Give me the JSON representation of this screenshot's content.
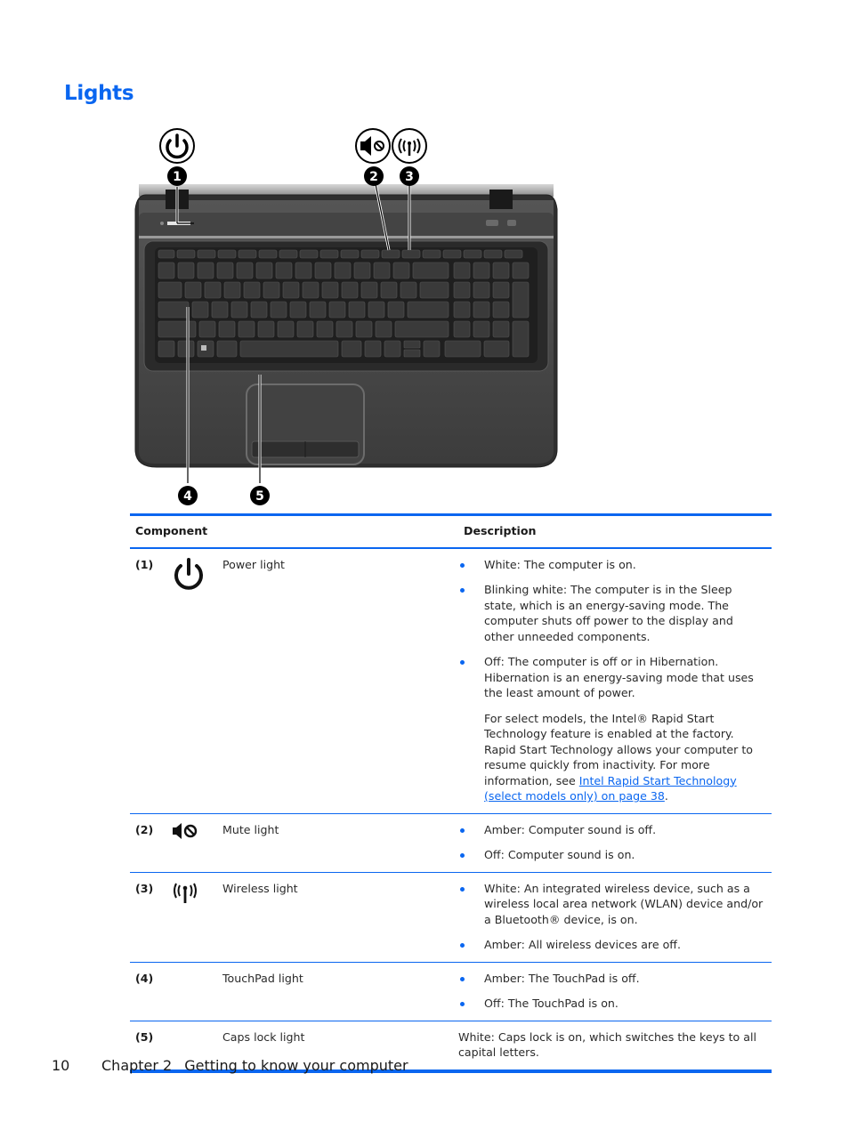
{
  "page": {
    "title": "Lights",
    "footer": {
      "page_number": "10",
      "chapter": "Chapter 2",
      "chapter_title": "Getting to know your computer"
    }
  },
  "figure": {
    "callouts": [
      "1",
      "2",
      "3",
      "4",
      "5"
    ],
    "callout_icons": [
      "power-icon",
      "mute-icon",
      "wireless-icon"
    ]
  },
  "table": {
    "headers": {
      "component": "Component",
      "description": "Description"
    },
    "rows": [
      {
        "num": "(1)",
        "icon": "power-icon",
        "name": "Power light",
        "bullets": [
          "White: The computer is on.",
          "Blinking white: The computer is in the Sleep state, which is an energy-saving mode. The computer shuts off power to the display and other unneeded components.",
          "Off: The computer is off or in Hibernation. Hibernation is an energy-saving mode that uses the least amount of power."
        ],
        "note": "For select models, the Intel® Rapid Start Technology feature is enabled at the factory. Rapid Start Technology allows your computer to resume quickly from inactivity. For more information, see ",
        "note_link": "Intel Rapid Start Technology (select models only) on page 38",
        "note_end": "."
      },
      {
        "num": "(2)",
        "icon": "mute-icon",
        "name": "Mute light",
        "bullets": [
          "Amber: Computer sound is off.",
          "Off: Computer sound is on."
        ]
      },
      {
        "num": "(3)",
        "icon": "wireless-icon",
        "name": "Wireless light",
        "bullets": [
          "White: An integrated wireless device, such as a wireless local area network (WLAN) device and/or a Bluetooth® device, is on.",
          "Amber: All wireless devices are off."
        ]
      },
      {
        "num": "(4)",
        "icon": "",
        "name": "TouchPad light",
        "bullets": [
          "Amber: The TouchPad is off.",
          "Off: The TouchPad is on."
        ]
      },
      {
        "num": "(5)",
        "icon": "",
        "name": "Caps lock light",
        "text": "White: Caps lock is on, which switches the keys to all capital letters."
      }
    ]
  },
  "colors": {
    "accent": "#0a66f0",
    "text": "#1a1a1a"
  }
}
